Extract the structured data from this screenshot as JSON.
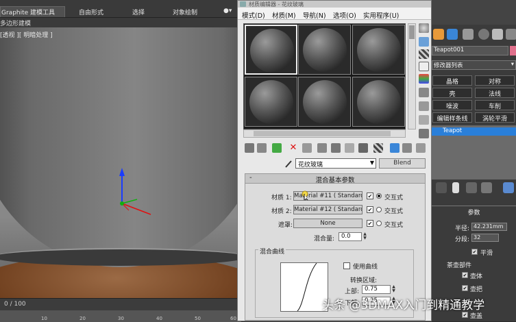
{
  "topbar": {
    "tab_graphite": "Graphite 建模工具",
    "tab_freeform": "自由形式",
    "tab_select": "选择",
    "tab_paint": "对象绘制",
    "sub_label": "多边形建模"
  },
  "viewport": {
    "label": "[透视 ][ 明暗处理 ]"
  },
  "timeline": {
    "frame_label": "0 / 100",
    "ticks": [
      "10",
      "20",
      "30",
      "40",
      "50",
      "60"
    ]
  },
  "material_editor": {
    "title": "材质编辑器 - 花纹玻璃",
    "menu": [
      "模式(D)",
      "材质(M)",
      "导航(N)",
      "选项(O)",
      "实用程序(U)"
    ],
    "material_name": "花纹玻璃",
    "material_type": "Blend",
    "rollout_title": "混合基本参数",
    "material1_label": "材质 1:",
    "material1_value": "Material #11  ( Standard )",
    "material2_label": "材质 2:",
    "material2_value": "Material #12  ( Standard )",
    "mask_label": "遮罩:",
    "mask_value": "None",
    "interactive_label": "交互式",
    "mix_amount_label": "混合量:",
    "mix_amount_value": "0.0",
    "curve_group_title": "混合曲线",
    "use_curve_label": "使用曲线",
    "transition_label": "转换区域:",
    "upper_label": "上部:",
    "upper_value": "0.75",
    "lower_label": "下部:",
    "lower_value": "0.25"
  },
  "command_panel": {
    "object_name": "Teapot001",
    "modifier_list": "修改器列表",
    "buttons": [
      "晶格",
      "对称",
      "壳",
      "法线",
      "噪波",
      "车削",
      "编辑样条线",
      "涡轮平滑"
    ],
    "stack_item": "Teapot",
    "params_title": "参数",
    "radius_label": "半径:",
    "radius_value": "42.231mm",
    "segments_label": "分段:",
    "segments_value": "32",
    "smooth_label": "平滑",
    "parts_title": "茶壶部件",
    "part_body": "壶体",
    "part_handle": "壶把",
    "part_lid": "壶盖",
    "object_color": "#e0708c"
  },
  "watermark": "头条 @3DMAX入门到精通教学"
}
